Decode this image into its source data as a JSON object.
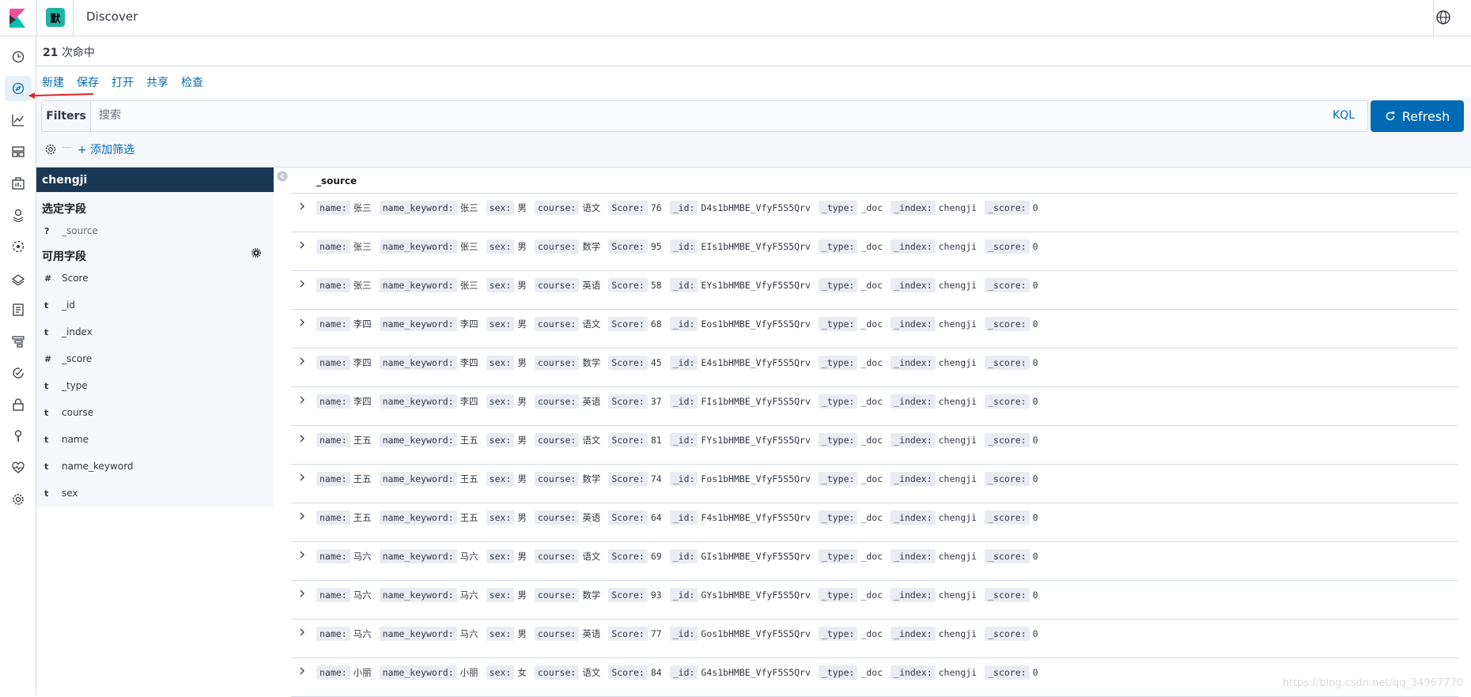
{
  "header": {
    "space_initial": "默",
    "title": "Discover"
  },
  "hits": {
    "count": "21",
    "label": "次命中"
  },
  "menu": [
    "新建",
    "保存",
    "打开",
    "共享",
    "检查"
  ],
  "query": {
    "filters_label": "Filters",
    "placeholder": "搜索",
    "language": "KQL",
    "refresh_label": "Refresh",
    "add_filter": "+ 添加筛选"
  },
  "sidebar": {
    "index": "chengji",
    "selected_title": "选定字段",
    "selected_fields": [
      {
        "type": "?",
        "name": "_source"
      }
    ],
    "available_title": "可用字段",
    "available_fields": [
      {
        "type": "#",
        "name": "Score"
      },
      {
        "type": "t",
        "name": "_id"
      },
      {
        "type": "t",
        "name": "_index"
      },
      {
        "type": "#",
        "name": "_score"
      },
      {
        "type": "t",
        "name": "_type"
      },
      {
        "type": "t",
        "name": "course"
      },
      {
        "type": "t",
        "name": "name"
      },
      {
        "type": "t",
        "name": "name_keyword"
      },
      {
        "type": "t",
        "name": "sex"
      }
    ]
  },
  "table": {
    "column": "_source",
    "keys": [
      "name:",
      "name_keyword:",
      "sex:",
      "course:",
      "Score:",
      "_id:",
      "_type:",
      "_index:",
      "_score:"
    ],
    "rows": [
      [
        "张三",
        "张三",
        "男",
        "语文",
        "76",
        "D4s1bHMBE_VfyF5S5Qrv",
        "_doc",
        "chengji",
        "0"
      ],
      [
        "张三",
        "张三",
        "男",
        "数学",
        "95",
        "EIs1bHMBE_VfyF5S5Qrv",
        "_doc",
        "chengji",
        "0"
      ],
      [
        "张三",
        "张三",
        "男",
        "英语",
        "58",
        "EYs1bHMBE_VfyF5S5Qrv",
        "_doc",
        "chengji",
        "0"
      ],
      [
        "李四",
        "李四",
        "男",
        "语文",
        "68",
        "Eos1bHMBE_VfyF5S5Qrv",
        "_doc",
        "chengji",
        "0"
      ],
      [
        "李四",
        "李四",
        "男",
        "数学",
        "45",
        "E4s1bHMBE_VfyF5S5Qrv",
        "_doc",
        "chengji",
        "0"
      ],
      [
        "李四",
        "李四",
        "男",
        "英语",
        "37",
        "FIs1bHMBE_VfyF5S5Qrv",
        "_doc",
        "chengji",
        "0"
      ],
      [
        "王五",
        "王五",
        "男",
        "语文",
        "81",
        "FYs1bHMBE_VfyF5S5Qrv",
        "_doc",
        "chengji",
        "0"
      ],
      [
        "王五",
        "王五",
        "男",
        "数学",
        "74",
        "Fos1bHMBE_VfyF5S5Qrv",
        "_doc",
        "chengji",
        "0"
      ],
      [
        "王五",
        "王五",
        "男",
        "英语",
        "64",
        "F4s1bHMBE_VfyF5S5Qrv",
        "_doc",
        "chengji",
        "0"
      ],
      [
        "马六",
        "马六",
        "男",
        "语文",
        "69",
        "GIs1bHMBE_VfyF5S5Qrv",
        "_doc",
        "chengji",
        "0"
      ],
      [
        "马六",
        "马六",
        "男",
        "数学",
        "93",
        "GYs1bHMBE_VfyF5S5Qrv",
        "_doc",
        "chengji",
        "0"
      ],
      [
        "马六",
        "马六",
        "男",
        "英语",
        "77",
        "Gos1bHMBE_VfyF5S5Qrv",
        "_doc",
        "chengji",
        "0"
      ],
      [
        "小丽",
        "小丽",
        "女",
        "语文",
        "84",
        "G4s1bHMBE_VfyF5S5Qrv",
        "_doc",
        "chengji",
        "0"
      ]
    ]
  },
  "watermark": "https://blog.csdn.net/qq_34967770",
  "colors": {
    "primary": "#006bb4",
    "index_header": "#1a3754",
    "space_avatar": "#20b2a5",
    "annotation_arrow": "#e02020"
  }
}
